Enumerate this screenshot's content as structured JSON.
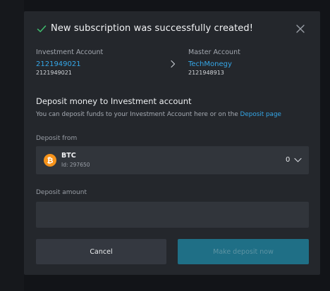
{
  "modal": {
    "title": "New subscription was successfully created!",
    "accent_color": "#35a7e8",
    "success_color": "#3fbf6f"
  },
  "investment_account": {
    "label": "Investment Account",
    "name": "2121949021",
    "number": "2121949021"
  },
  "master_account": {
    "label": "Master Account",
    "name": "TechMonegy",
    "number": "2121948913"
  },
  "deposit": {
    "title": "Deposit money to Investment account",
    "description": "You can deposit funds to your Investment Account here or on the ",
    "description_link": "Deposit page",
    "from_label": "Deposit from",
    "source": {
      "currency": "BTC",
      "id_text": "Id: 297650",
      "balance": "0",
      "icon": "bitcoin-icon"
    },
    "amount_label": "Deposit amount",
    "amount_value": "",
    "amount_placeholder": ""
  },
  "buttons": {
    "cancel": "Cancel",
    "submit": "Make deposit now"
  }
}
